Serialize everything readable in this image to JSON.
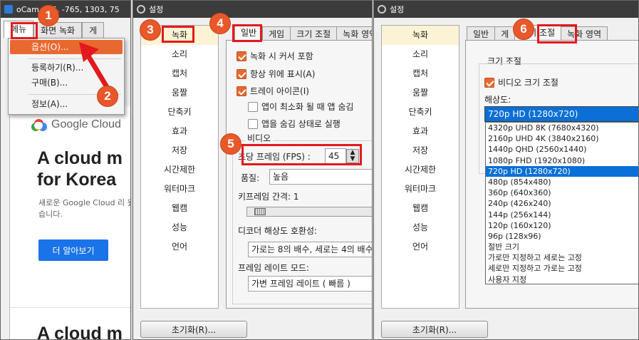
{
  "winA": {
    "title": "oCam - 65, -765, 1303, 75",
    "tabs": [
      "메뉴",
      "화면 녹화",
      "게"
    ],
    "menu": [
      "옵션(O)...",
      "등록하기(R)...",
      "구매(B)...",
      "정보(A)..."
    ],
    "browser": {
      "brand": "Google Cloud",
      "headline1": "A cloud m",
      "headline2": "for Korea",
      "sub": "새로운 Google Cloud 리 왔습니다.",
      "button": "더 알아보기",
      "headline3": "A cloud m"
    }
  },
  "winB": {
    "title": "설정",
    "sidebar": [
      "녹화",
      "소리",
      "캡처",
      "움짤",
      "단축키",
      "효과",
      "저장",
      "시간제한",
      "워터마크",
      "웹캠",
      "성능",
      "언어"
    ],
    "tabs": [
      "일반",
      "게임",
      "크기 조절",
      "녹화 영역"
    ],
    "checks": [
      {
        "label": "녹화 시 커서 포함",
        "checked": true
      },
      {
        "label": "항상 위에 표시(A)",
        "checked": true
      },
      {
        "label": "트레이 아이콘(I)",
        "checked": true
      },
      {
        "label": "앱이 최소화 될 때 앱 숨김",
        "checked": false
      },
      {
        "label": "앱을 숨김 상태로 실행",
        "checked": false
      }
    ],
    "video_group": "비디오",
    "fps_label": "초당 프레임 (FPS) :",
    "fps_value": "45",
    "quality_label": "품질:",
    "quality_value": "높음",
    "keyframe_label": "키프레임 간격: 1",
    "decoder_label": "디코더 해상도 호환성:",
    "decoder_value": "가로는 8의 배수, 세로는 4의 배수",
    "rate_mode_label": "프레임 레이트 모드:",
    "rate_mode_value": "가변 프레임 레이트 ( 빠름 )",
    "reset_button": "초기화(R)..."
  },
  "winC": {
    "title": "설정",
    "tabs": [
      "일반",
      "게",
      "크기 조절",
      "녹화 영역"
    ],
    "group_title": "크기 조절",
    "video_resize": "비디오 크기 조절",
    "resolution_label": "해상도:",
    "resolution_value": "720p HD (1280x720)",
    "options": [
      "4320p UHD 8K (7680x4320)",
      "2160p UHD 4K (3840x2160)",
      "1440p QHD (2560x1440)",
      "1080p FHD (1920x1080)",
      "720p HD (1280x720)",
      "480p (854x480)",
      "360p (640x360)",
      "240p (426x240)",
      "144p (256x144)",
      "120p (160x120)",
      "96p (128x96)",
      "절반 크기",
      "가로만 지정하고 세로는 고정",
      "세로만 지정하고 가로는 고정",
      "사용자 지정"
    ],
    "selected_index": 4,
    "reset_button": "초기화(R)..."
  },
  "steps": [
    "1",
    "2",
    "3",
    "4",
    "5",
    "6"
  ],
  "colors": {
    "accent": "#e8582a",
    "highlight_box": "#e3191e",
    "selection": "#0a6fd6"
  }
}
